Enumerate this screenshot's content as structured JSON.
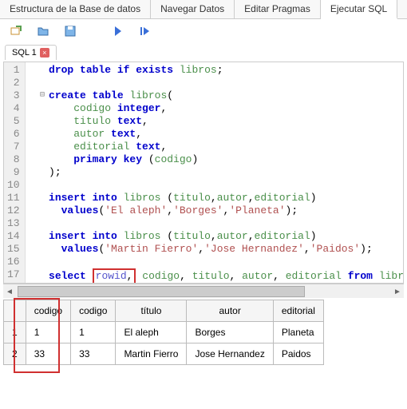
{
  "tabs": {
    "items": [
      "Estructura de la Base de datos",
      "Navegar Datos",
      "Editar Pragmas",
      "Ejecutar SQL"
    ],
    "active": 3
  },
  "sql_tab": {
    "label": "SQL 1",
    "close": "×"
  },
  "code_lines": [
    {
      "n": 1,
      "tokens": [
        {
          "t": "   ",
          "c": ""
        },
        {
          "t": "drop table",
          "c": "kw"
        },
        {
          "t": " ",
          "c": ""
        },
        {
          "t": "if exists",
          "c": "kw"
        },
        {
          "t": " ",
          "c": ""
        },
        {
          "t": "libros",
          "c": "id"
        },
        {
          "t": ";",
          "c": ""
        }
      ]
    },
    {
      "n": 2,
      "tokens": []
    },
    {
      "n": 3,
      "tokens": [
        {
          "t": "   ",
          "c": ""
        },
        {
          "t": "create table",
          "c": "kw"
        },
        {
          "t": " ",
          "c": ""
        },
        {
          "t": "libros",
          "c": "id"
        },
        {
          "t": "(",
          "c": ""
        }
      ]
    },
    {
      "n": 4,
      "tokens": [
        {
          "t": "       ",
          "c": ""
        },
        {
          "t": "codigo ",
          "c": "id"
        },
        {
          "t": "integer",
          "c": "kw"
        },
        {
          "t": ",",
          "c": ""
        }
      ]
    },
    {
      "n": 5,
      "tokens": [
        {
          "t": "       ",
          "c": ""
        },
        {
          "t": "titulo ",
          "c": "id"
        },
        {
          "t": "text",
          "c": "kw"
        },
        {
          "t": ",",
          "c": ""
        }
      ]
    },
    {
      "n": 6,
      "tokens": [
        {
          "t": "       ",
          "c": ""
        },
        {
          "t": "autor ",
          "c": "id"
        },
        {
          "t": "text",
          "c": "kw"
        },
        {
          "t": ",",
          "c": ""
        }
      ]
    },
    {
      "n": 7,
      "tokens": [
        {
          "t": "       ",
          "c": ""
        },
        {
          "t": "editorial ",
          "c": "id"
        },
        {
          "t": "text",
          "c": "kw"
        },
        {
          "t": ",",
          "c": ""
        }
      ]
    },
    {
      "n": 8,
      "tokens": [
        {
          "t": "       ",
          "c": ""
        },
        {
          "t": "primary key",
          "c": "kw"
        },
        {
          "t": " (",
          "c": ""
        },
        {
          "t": "codigo",
          "c": "id"
        },
        {
          "t": ")",
          "c": ""
        }
      ]
    },
    {
      "n": 9,
      "tokens": [
        {
          "t": "   );",
          "c": ""
        }
      ]
    },
    {
      "n": 10,
      "tokens": []
    },
    {
      "n": 11,
      "tokens": [
        {
          "t": "   ",
          "c": ""
        },
        {
          "t": "insert into",
          "c": "kw"
        },
        {
          "t": " ",
          "c": ""
        },
        {
          "t": "libros",
          "c": "id"
        },
        {
          "t": " (",
          "c": ""
        },
        {
          "t": "titulo",
          "c": "id"
        },
        {
          "t": ",",
          "c": ""
        },
        {
          "t": "autor",
          "c": "id"
        },
        {
          "t": ",",
          "c": ""
        },
        {
          "t": "editorial",
          "c": "id"
        },
        {
          "t": ")",
          "c": ""
        }
      ]
    },
    {
      "n": 12,
      "tokens": [
        {
          "t": "     ",
          "c": ""
        },
        {
          "t": "values",
          "c": "kw"
        },
        {
          "t": "(",
          "c": ""
        },
        {
          "t": "'El aleph'",
          "c": "str"
        },
        {
          "t": ",",
          "c": ""
        },
        {
          "t": "'Borges'",
          "c": "str"
        },
        {
          "t": ",",
          "c": ""
        },
        {
          "t": "'Planeta'",
          "c": "str"
        },
        {
          "t": ");",
          "c": ""
        }
      ]
    },
    {
      "n": 13,
      "tokens": []
    },
    {
      "n": 14,
      "tokens": [
        {
          "t": "   ",
          "c": ""
        },
        {
          "t": "insert into",
          "c": "kw"
        },
        {
          "t": " ",
          "c": ""
        },
        {
          "t": "libros",
          "c": "id"
        },
        {
          "t": " (",
          "c": ""
        },
        {
          "t": "titulo",
          "c": "id"
        },
        {
          "t": ",",
          "c": ""
        },
        {
          "t": "autor",
          "c": "id"
        },
        {
          "t": ",",
          "c": ""
        },
        {
          "t": "editorial",
          "c": "id"
        },
        {
          "t": ")",
          "c": ""
        }
      ]
    },
    {
      "n": 15,
      "tokens": [
        {
          "t": "     ",
          "c": ""
        },
        {
          "t": "values",
          "c": "kw"
        },
        {
          "t": "(",
          "c": ""
        },
        {
          "t": "'Martin Fierro'",
          "c": "str"
        },
        {
          "t": ",",
          "c": ""
        },
        {
          "t": "'Jose Hernandez'",
          "c": "str"
        },
        {
          "t": ",",
          "c": ""
        },
        {
          "t": "'Paidos'",
          "c": "str"
        },
        {
          "t": ");",
          "c": ""
        }
      ]
    },
    {
      "n": 16,
      "tokens": []
    },
    {
      "n": 17,
      "tokens": [
        {
          "t": "   ",
          "c": ""
        },
        {
          "t": "select",
          "c": "kw"
        },
        {
          "t": " ",
          "c": ""
        },
        {
          "t": "rowid",
          "c": "fn",
          "box": true
        },
        {
          "t": ",",
          "c": "",
          "box": true
        },
        {
          "t": " ",
          "c": ""
        },
        {
          "t": "codigo",
          "c": "id"
        },
        {
          "t": ", ",
          "c": ""
        },
        {
          "t": "titulo",
          "c": "id"
        },
        {
          "t": ", ",
          "c": ""
        },
        {
          "t": "autor",
          "c": "id"
        },
        {
          "t": ", ",
          "c": ""
        },
        {
          "t": "editorial",
          "c": "id"
        },
        {
          "t": " ",
          "c": ""
        },
        {
          "t": "from",
          "c": "kw"
        },
        {
          "t": " ",
          "c": ""
        },
        {
          "t": "libros",
          "c": "id"
        },
        {
          "t": ";",
          "c": ""
        }
      ]
    }
  ],
  "results": {
    "headers": [
      "codigo",
      "codigo",
      "título",
      "autor",
      "editorial"
    ],
    "rows": [
      {
        "n": "1",
        "cells": [
          "1",
          "1",
          "El aleph",
          "Borges",
          "Planeta"
        ]
      },
      {
        "n": "2",
        "cells": [
          "33",
          "33",
          "Martin Fierro",
          "Jose Hernandez",
          "Paidos"
        ]
      }
    ]
  }
}
